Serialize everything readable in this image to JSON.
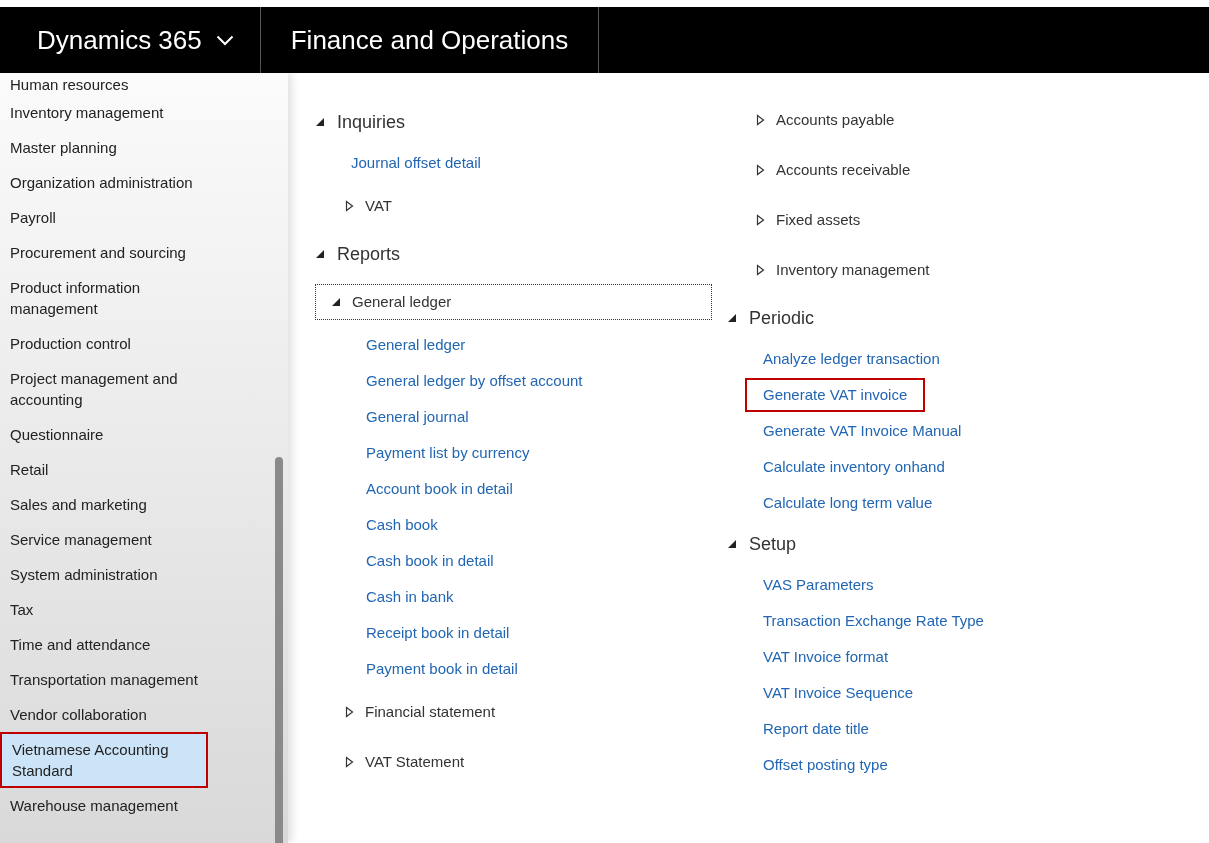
{
  "header": {
    "app_name": "Dynamics 365",
    "module": "Finance and Operations"
  },
  "sidebar": {
    "items": [
      {
        "label": "Human resources",
        "selected": false,
        "highlighted": false
      },
      {
        "label": "Inventory management",
        "selected": false,
        "highlighted": false
      },
      {
        "label": "Master planning",
        "selected": false,
        "highlighted": false
      },
      {
        "label": "Organization administration",
        "selected": false,
        "highlighted": false
      },
      {
        "label": "Payroll",
        "selected": false,
        "highlighted": false
      },
      {
        "label": "Procurement and sourcing",
        "selected": false,
        "highlighted": false
      },
      {
        "label": "Product information management",
        "selected": false,
        "highlighted": false
      },
      {
        "label": "Production control",
        "selected": false,
        "highlighted": false
      },
      {
        "label": "Project management and accounting",
        "selected": false,
        "highlighted": false
      },
      {
        "label": "Questionnaire",
        "selected": false,
        "highlighted": false
      },
      {
        "label": "Retail",
        "selected": false,
        "highlighted": false
      },
      {
        "label": "Sales and marketing",
        "selected": false,
        "highlighted": false
      },
      {
        "label": "Service management",
        "selected": false,
        "highlighted": false
      },
      {
        "label": "System administration",
        "selected": false,
        "highlighted": false
      },
      {
        "label": "Tax",
        "selected": false,
        "highlighted": false
      },
      {
        "label": "Time and attendance",
        "selected": false,
        "highlighted": false
      },
      {
        "label": "Transportation management",
        "selected": false,
        "highlighted": false
      },
      {
        "label": "Vendor collaboration",
        "selected": false,
        "highlighted": false
      },
      {
        "label": "Vietnamese Accounting Standard",
        "selected": true,
        "highlighted": true
      },
      {
        "label": "Warehouse management",
        "selected": false,
        "highlighted": false
      }
    ]
  },
  "columns": [
    [
      {
        "kind": "section",
        "label": "Inquiries",
        "expanded": true,
        "children": [
          {
            "kind": "link",
            "label": "Journal offset detail",
            "highlighted": false
          },
          {
            "kind": "group",
            "label": "VAT",
            "expanded": false,
            "focused": false
          }
        ]
      },
      {
        "kind": "section",
        "label": "Reports",
        "expanded": true,
        "children": [
          {
            "kind": "group",
            "label": "General ledger",
            "expanded": true,
            "focused": true,
            "children": [
              {
                "kind": "link",
                "label": "General ledger",
                "highlighted": false
              },
              {
                "kind": "link",
                "label": "General ledger by offset account",
                "highlighted": false
              },
              {
                "kind": "link",
                "label": "General journal",
                "highlighted": false
              },
              {
                "kind": "link",
                "label": "Payment list by currency",
                "highlighted": false
              },
              {
                "kind": "link",
                "label": "Account book in detail",
                "highlighted": false
              },
              {
                "kind": "link",
                "label": "Cash book",
                "highlighted": false
              },
              {
                "kind": "link",
                "label": "Cash book in detail",
                "highlighted": false
              },
              {
                "kind": "link",
                "label": "Cash in bank",
                "highlighted": false
              },
              {
                "kind": "link",
                "label": "Receipt book in detail",
                "highlighted": false
              },
              {
                "kind": "link",
                "label": "Payment book in detail",
                "highlighted": false
              }
            ]
          },
          {
            "kind": "group",
            "label": "Financial statement",
            "expanded": false,
            "focused": false
          },
          {
            "kind": "group",
            "label": "VAT Statement",
            "expanded": false,
            "focused": false
          }
        ]
      }
    ],
    [
      {
        "kind": "group",
        "label": "Accounts payable",
        "expanded": false,
        "focused": false
      },
      {
        "kind": "group",
        "label": "Accounts receivable",
        "expanded": false,
        "focused": false
      },
      {
        "kind": "group",
        "label": "Fixed assets",
        "expanded": false,
        "focused": false
      },
      {
        "kind": "group",
        "label": "Inventory management",
        "expanded": false,
        "focused": false
      },
      {
        "kind": "section",
        "label": "Periodic",
        "expanded": true,
        "children": [
          {
            "kind": "link",
            "label": "Analyze ledger transaction",
            "highlighted": false
          },
          {
            "kind": "link",
            "label": "Generate VAT invoice",
            "highlighted": true
          },
          {
            "kind": "link",
            "label": "Generate VAT Invoice Manual",
            "highlighted": false
          },
          {
            "kind": "link",
            "label": "Calculate inventory onhand",
            "highlighted": false
          },
          {
            "kind": "link",
            "label": "Calculate long term value",
            "highlighted": false
          }
        ]
      },
      {
        "kind": "section",
        "label": "Setup",
        "expanded": true,
        "children": [
          {
            "kind": "link",
            "label": "VAS Parameters",
            "highlighted": false
          },
          {
            "kind": "link",
            "label": "Transaction Exchange Rate Type",
            "highlighted": false
          },
          {
            "kind": "link",
            "label": "VAT Invoice format",
            "highlighted": false
          },
          {
            "kind": "link",
            "label": "VAT Invoice Sequence",
            "highlighted": false
          },
          {
            "kind": "link",
            "label": "Report date title",
            "highlighted": false
          },
          {
            "kind": "link",
            "label": "Offset posting type",
            "highlighted": false
          }
        ]
      }
    ]
  ]
}
